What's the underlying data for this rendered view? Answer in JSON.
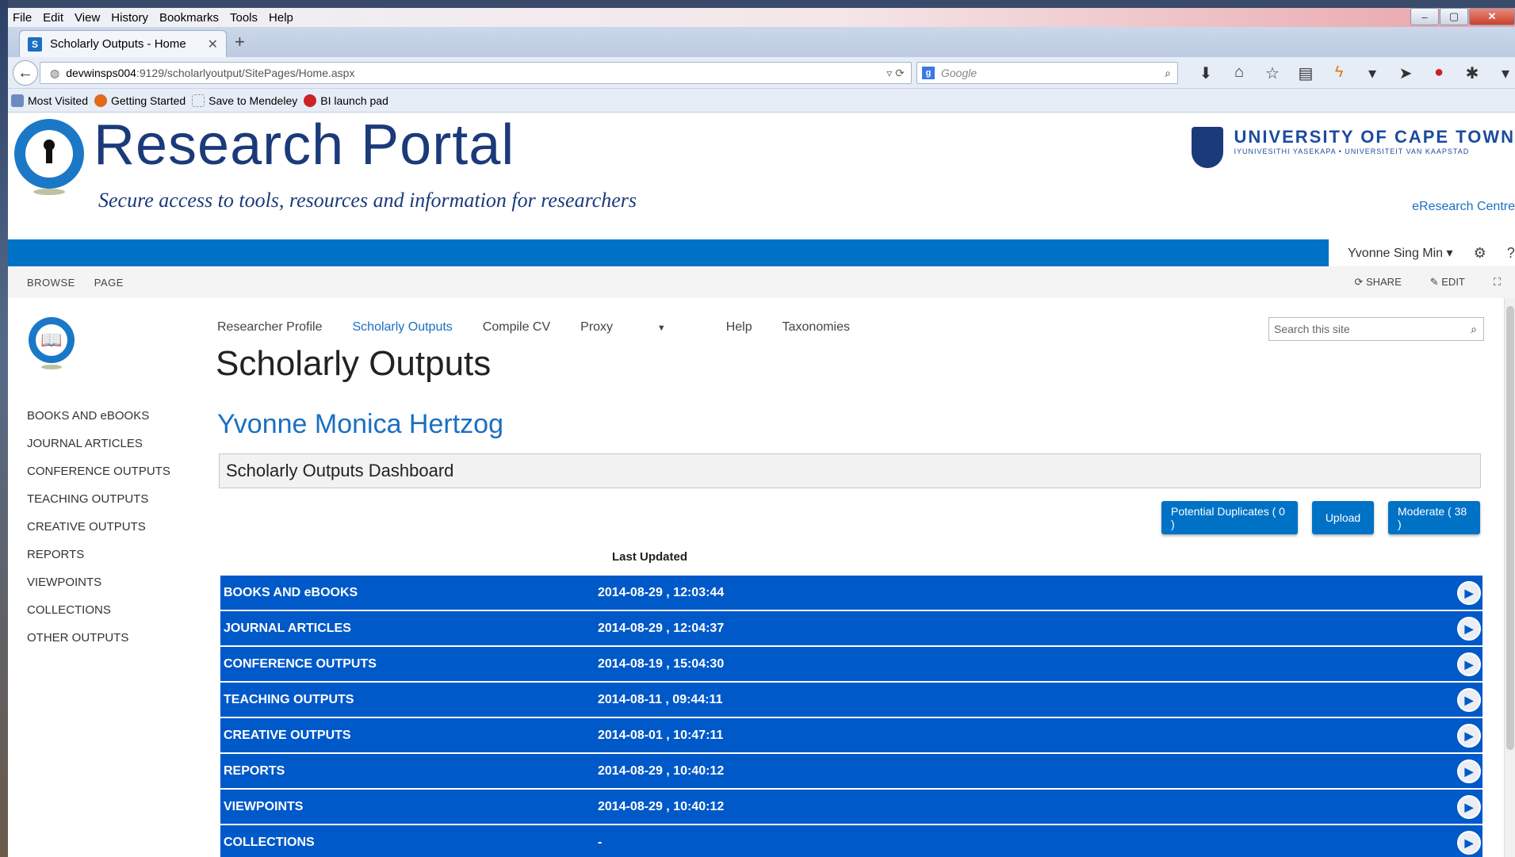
{
  "browser": {
    "menu": [
      "File",
      "Edit",
      "View",
      "History",
      "Bookmarks",
      "Tools",
      "Help"
    ],
    "tab_title": "Scholarly Outputs - Home",
    "url_host": "devwinsps004",
    "url_path": ":9129/scholarlyoutput/SitePages/Home.aspx",
    "search_placeholder": "Google",
    "bookmarks": [
      "Most Visited",
      "Getting Started",
      "Save to Mendeley",
      "BI launch pad"
    ]
  },
  "header": {
    "title": "Research Portal",
    "subtitle": "Secure access to tools, resources and information for researchers",
    "university": "UNIVERSITY OF CAPE TOWN",
    "university_sub": "IYUNIVESITHI YASEKAPA • UNIVERSITEIT VAN KAAPSTAD",
    "centre_link": "eResearch Centre"
  },
  "user": {
    "name": "Yvonne Sing Min"
  },
  "ribbon": {
    "browse": "BROWSE",
    "page": "PAGE",
    "share": "SHARE",
    "edit": "EDIT"
  },
  "topnav": [
    "Researcher Profile",
    "Scholarly Outputs",
    "Compile CV",
    "Proxy",
    "Help",
    "Taxonomies"
  ],
  "search_site_placeholder": "Search this site",
  "page_title": "Scholarly Outputs",
  "leftnav": [
    "BOOKS AND eBOOKS",
    "JOURNAL ARTICLES",
    "CONFERENCE OUTPUTS",
    "TEACHING OUTPUTS",
    "CREATIVE OUTPUTS",
    "REPORTS",
    "VIEWPOINTS",
    "COLLECTIONS",
    "OTHER OUTPUTS"
  ],
  "person_name": "Yvonne Monica Hertzog",
  "dashboard_title": "Scholarly Outputs Dashboard",
  "buttons": {
    "duplicates": "Potential Duplicates ( 0 )",
    "upload": "Upload",
    "moderate": "Moderate ( 38 )"
  },
  "table": {
    "header_last_updated": "Last Updated",
    "rows": [
      {
        "name": "BOOKS AND eBOOKS",
        "updated": "2014-08-29 , 12:03:44"
      },
      {
        "name": "JOURNAL ARTICLES",
        "updated": "2014-08-29 , 12:04:37"
      },
      {
        "name": "CONFERENCE OUTPUTS",
        "updated": "2014-08-19 , 15:04:30"
      },
      {
        "name": "TEACHING OUTPUTS",
        "updated": "2014-08-11 , 09:44:11"
      },
      {
        "name": "CREATIVE OUTPUTS",
        "updated": "2014-08-01 , 10:47:11"
      },
      {
        "name": "REPORTS",
        "updated": "2014-08-29 , 10:40:12"
      },
      {
        "name": "VIEWPOINTS",
        "updated": "2014-08-29 , 10:40:12"
      },
      {
        "name": "COLLECTIONS",
        "updated": "-"
      }
    ]
  },
  "colors": {
    "sp_blue": "#0072c6",
    "row_blue": "#0059c8",
    "title_navy": "#1b3a7a"
  }
}
